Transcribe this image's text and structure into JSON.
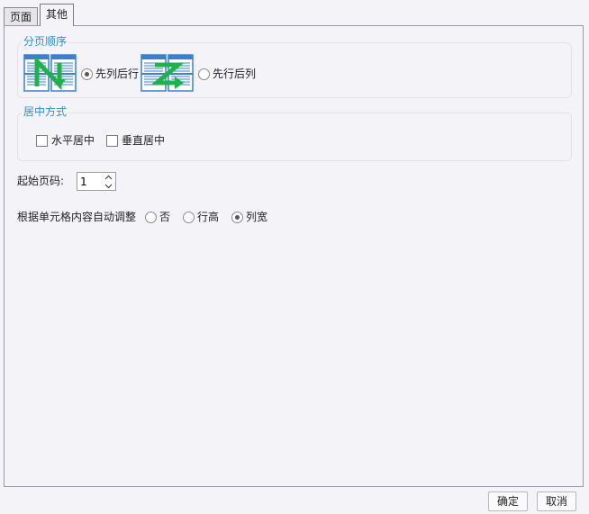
{
  "tabs": [
    {
      "label": "页面",
      "active": false
    },
    {
      "label": "其他",
      "active": true
    }
  ],
  "page_order": {
    "title": "分页顺序",
    "options": [
      {
        "label": "先列后行",
        "selected": true,
        "icon": "column-then-row-icon"
      },
      {
        "label": "先行后列",
        "selected": false,
        "icon": "row-then-column-icon"
      }
    ]
  },
  "centering": {
    "title": "居中方式",
    "options": [
      {
        "label": "水平居中",
        "checked": false
      },
      {
        "label": "垂直居中",
        "checked": false
      }
    ]
  },
  "start_page": {
    "label": "起始页码:",
    "value": "1"
  },
  "auto_adjust": {
    "label": "根据单元格内容自动调整",
    "options": [
      {
        "label": "否",
        "selected": false
      },
      {
        "label": "行高",
        "selected": false
      },
      {
        "label": "列宽",
        "selected": true
      }
    ]
  },
  "buttons": {
    "ok": "确定",
    "cancel": "取消"
  },
  "colors": {
    "accent": "#2f8fd0",
    "arrow_green": "#1fb24a",
    "page_blue": "#3a7fd0"
  }
}
